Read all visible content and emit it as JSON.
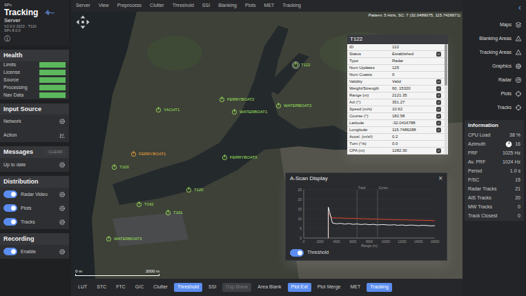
{
  "brand": {
    "pre": "SPx",
    "name": "Tracking",
    "sub": "Server",
    "version": "V2.0.0 2023 · T110",
    "build": "SPx 8.0.0",
    "info": "ⓘ"
  },
  "health": {
    "title": "Health",
    "items": [
      {
        "label": "Limits",
        "ok": true
      },
      {
        "label": "License",
        "ok": true
      },
      {
        "label": "Source",
        "ok": true
      },
      {
        "label": "Processing",
        "ok": true
      },
      {
        "label": "Nav Data",
        "ok": true
      }
    ]
  },
  "input_source": {
    "title": "Input Source",
    "items": [
      {
        "label": "Network"
      },
      {
        "label": "Action"
      }
    ]
  },
  "messages": {
    "title": "Messages",
    "clear": {
      "label": "CLEAR",
      "disabled": true
    },
    "status": "Up to date"
  },
  "distribution": {
    "title": "Distribution",
    "items": [
      {
        "label": "Radar Video",
        "on": true
      },
      {
        "label": "Plots",
        "on": true
      },
      {
        "label": "Tracks",
        "on": true
      }
    ]
  },
  "recording": {
    "title": "Recording",
    "items": [
      {
        "label": "Enable",
        "on": true
      }
    ]
  },
  "menu": [
    "Server",
    "View",
    "Preprocess",
    "Clutter",
    "Threshold",
    "SSI",
    "Blanking",
    "Plots",
    "MET",
    "Tracking"
  ],
  "map": {
    "pattern": "Pattern: 5 Hz/s, SC: 7  (32.0489075, 115.7426671)",
    "scale": {
      "start": "0 m",
      "end": "2000 m"
    },
    "tracks": [
      {
        "label": "T122",
        "color": "#9ee35a",
        "selected": true
      },
      {
        "label": "YACHT1",
        "color": "#9ee35a",
        "selected": false
      },
      {
        "label": "FERRYBOAT1",
        "color": "#f0a03c",
        "selected": false
      },
      {
        "label": "T103",
        "color": "#9ee35a",
        "selected": false
      },
      {
        "label": "FERRYBOAT2",
        "color": "#9ee35a",
        "selected": false
      },
      {
        "label": "WATERBOAT1",
        "color": "#9ee35a",
        "selected": false
      },
      {
        "label": "WATERBOAT2",
        "color": "#9ee35a",
        "selected": false
      },
      {
        "label": "FERRYBOAT3",
        "color": "#9ee35a",
        "selected": false
      },
      {
        "label": "T120",
        "color": "#9ee35a",
        "selected": false
      },
      {
        "label": "T101",
        "color": "#9ee35a",
        "selected": false
      },
      {
        "label": "WATERBOAT3",
        "color": "#9ee35a",
        "selected": false
      },
      {
        "label": "T142",
        "color": "#9ee35a",
        "selected": false
      }
    ]
  },
  "track_panel": {
    "title": "T122",
    "rows": [
      {
        "label": "ID",
        "value": "122",
        "kind": "plain"
      },
      {
        "label": "Status",
        "value": "Established",
        "kind": "check",
        "checked": true
      },
      {
        "label": "Type",
        "value": "Radar",
        "kind": "plain"
      },
      {
        "label": "Num Updates",
        "value": "125",
        "kind": "plain"
      },
      {
        "label": "Num Coasts",
        "value": "0",
        "kind": "plain"
      },
      {
        "label": "Validity",
        "value": "Valid",
        "kind": "check",
        "checked": true
      },
      {
        "label": "Weight/Strength",
        "value": "60, 15320",
        "kind": "check",
        "checked": true
      },
      {
        "label": "Range (m)",
        "value": "2121.35",
        "kind": "check",
        "checked": true
      },
      {
        "label": "Azi (°)",
        "value": "351.27",
        "kind": "check",
        "checked": true
      },
      {
        "label": "Speed (m/s)",
        "value": "10.62",
        "kind": "check",
        "checked": true
      },
      {
        "label": "Course (°)",
        "value": "182.58",
        "kind": "check",
        "checked": true
      },
      {
        "label": "Latitude",
        "value": "-32.0416788",
        "kind": "check",
        "checked": true
      },
      {
        "label": "Longitude",
        "value": "115.7486288",
        "kind": "check",
        "checked": true
      },
      {
        "label": "Accel. (m/s²)",
        "value": "0.2",
        "kind": "plain"
      },
      {
        "label": "Turn (°/s)",
        "value": "0.0",
        "kind": "plain"
      },
      {
        "label": "CPA (m)",
        "value": "1282.30",
        "kind": "check",
        "checked": true
      }
    ]
  },
  "ascan": {
    "title": "A-Scan Display",
    "close": "×",
    "y_ticks": [
      "25",
      "20",
      "15",
      "10",
      "5",
      "0"
    ],
    "x_ticks": [
      "0",
      "2000",
      "4000",
      "6000",
      "8000",
      "10000",
      "12000",
      "14000",
      "16000"
    ],
    "x_label": "Range (m)",
    "markers": [
      {
        "label": "Track",
        "value": 6500
      },
      {
        "label": "Cursor",
        "value": 9000
      }
    ],
    "series": [
      {
        "color": "#e0452f",
        "values": [
          0,
          0,
          0,
          0,
          0,
          0,
          13,
          10.5,
          10.4,
          10.4,
          10.3,
          10.2,
          10.2,
          10.1,
          10.0,
          10.0,
          9.9,
          9.8,
          9.8,
          9.7,
          9.6,
          9.6,
          9.5,
          9.5,
          9.4,
          9.4,
          9.3,
          9.3,
          9.2,
          9.2,
          9.1,
          9.1,
          9.0
        ]
      },
      {
        "color": "#f2f2f2",
        "values": [
          0,
          0,
          0,
          0,
          0,
          0,
          16,
          7.8,
          7.4,
          7.6,
          7.2,
          7.5,
          7.1,
          7.3,
          7.0,
          7.2,
          6.9,
          7.1,
          6.8,
          7.0,
          6.9,
          6.7,
          6.9,
          6.6,
          6.8,
          6.5,
          6.7,
          6.6,
          6.4,
          6.6,
          6.5,
          6.3,
          6.4
        ]
      }
    ],
    "toggle": {
      "label": "Threshold",
      "on": true
    }
  },
  "bottom_bar": [
    {
      "label": "LUT",
      "selected": false,
      "disabled": false
    },
    {
      "label": "STC",
      "selected": false,
      "disabled": false
    },
    {
      "label": "FTC",
      "selected": false,
      "disabled": false
    },
    {
      "label": "G/C",
      "selected": false,
      "disabled": false
    },
    {
      "label": "Clutter",
      "selected": false,
      "disabled": false
    },
    {
      "label": "Threshold",
      "selected": true,
      "disabled": false
    },
    {
      "label": "SSI",
      "selected": false,
      "disabled": false
    },
    {
      "label": "Dsp Blank",
      "selected": false,
      "disabled": true
    },
    {
      "label": "Area Blank",
      "selected": false,
      "disabled": false
    },
    {
      "label": "Plot Ext",
      "selected": true,
      "disabled": false
    },
    {
      "label": "Plot Merge",
      "selected": false,
      "disabled": false
    },
    {
      "label": "MET",
      "selected": false,
      "disabled": false
    },
    {
      "label": "Tracking",
      "selected": true,
      "disabled": false
    }
  ],
  "right_panel": {
    "collapse": "‹",
    "items": [
      {
        "label": "Maps"
      },
      {
        "label": "Blanking Areas"
      },
      {
        "label": "Tracking Areas"
      },
      {
        "label": "Graphics"
      },
      {
        "label": "Radar"
      },
      {
        "label": "Plots"
      },
      {
        "label": "Tracks"
      }
    ],
    "info": {
      "title": "Information",
      "rows": [
        {
          "label": "CPU Load",
          "value": "38 %",
          "kind": "text"
        },
        {
          "label": "Azimuth",
          "value": "16",
          "kind": "dial",
          "level": 0.044
        },
        {
          "label": "PRF",
          "value": "1025 Hz",
          "kind": "text"
        },
        {
          "label": "Av. PRF",
          "value": "1024 Hz",
          "kind": "text"
        },
        {
          "label": "Period",
          "value": "1.0 s",
          "kind": "text"
        },
        {
          "label": "P/SC",
          "value": "15",
          "kind": "text"
        },
        {
          "label": "Radar Tracks",
          "value": "21",
          "kind": "text"
        },
        {
          "label": "AIS Tracks",
          "value": "20",
          "kind": "text"
        },
        {
          "label": "MW Tracks",
          "value": "0",
          "kind": "text"
        },
        {
          "label": "Track Closest",
          "value": "0",
          "kind": "text"
        }
      ]
    }
  }
}
